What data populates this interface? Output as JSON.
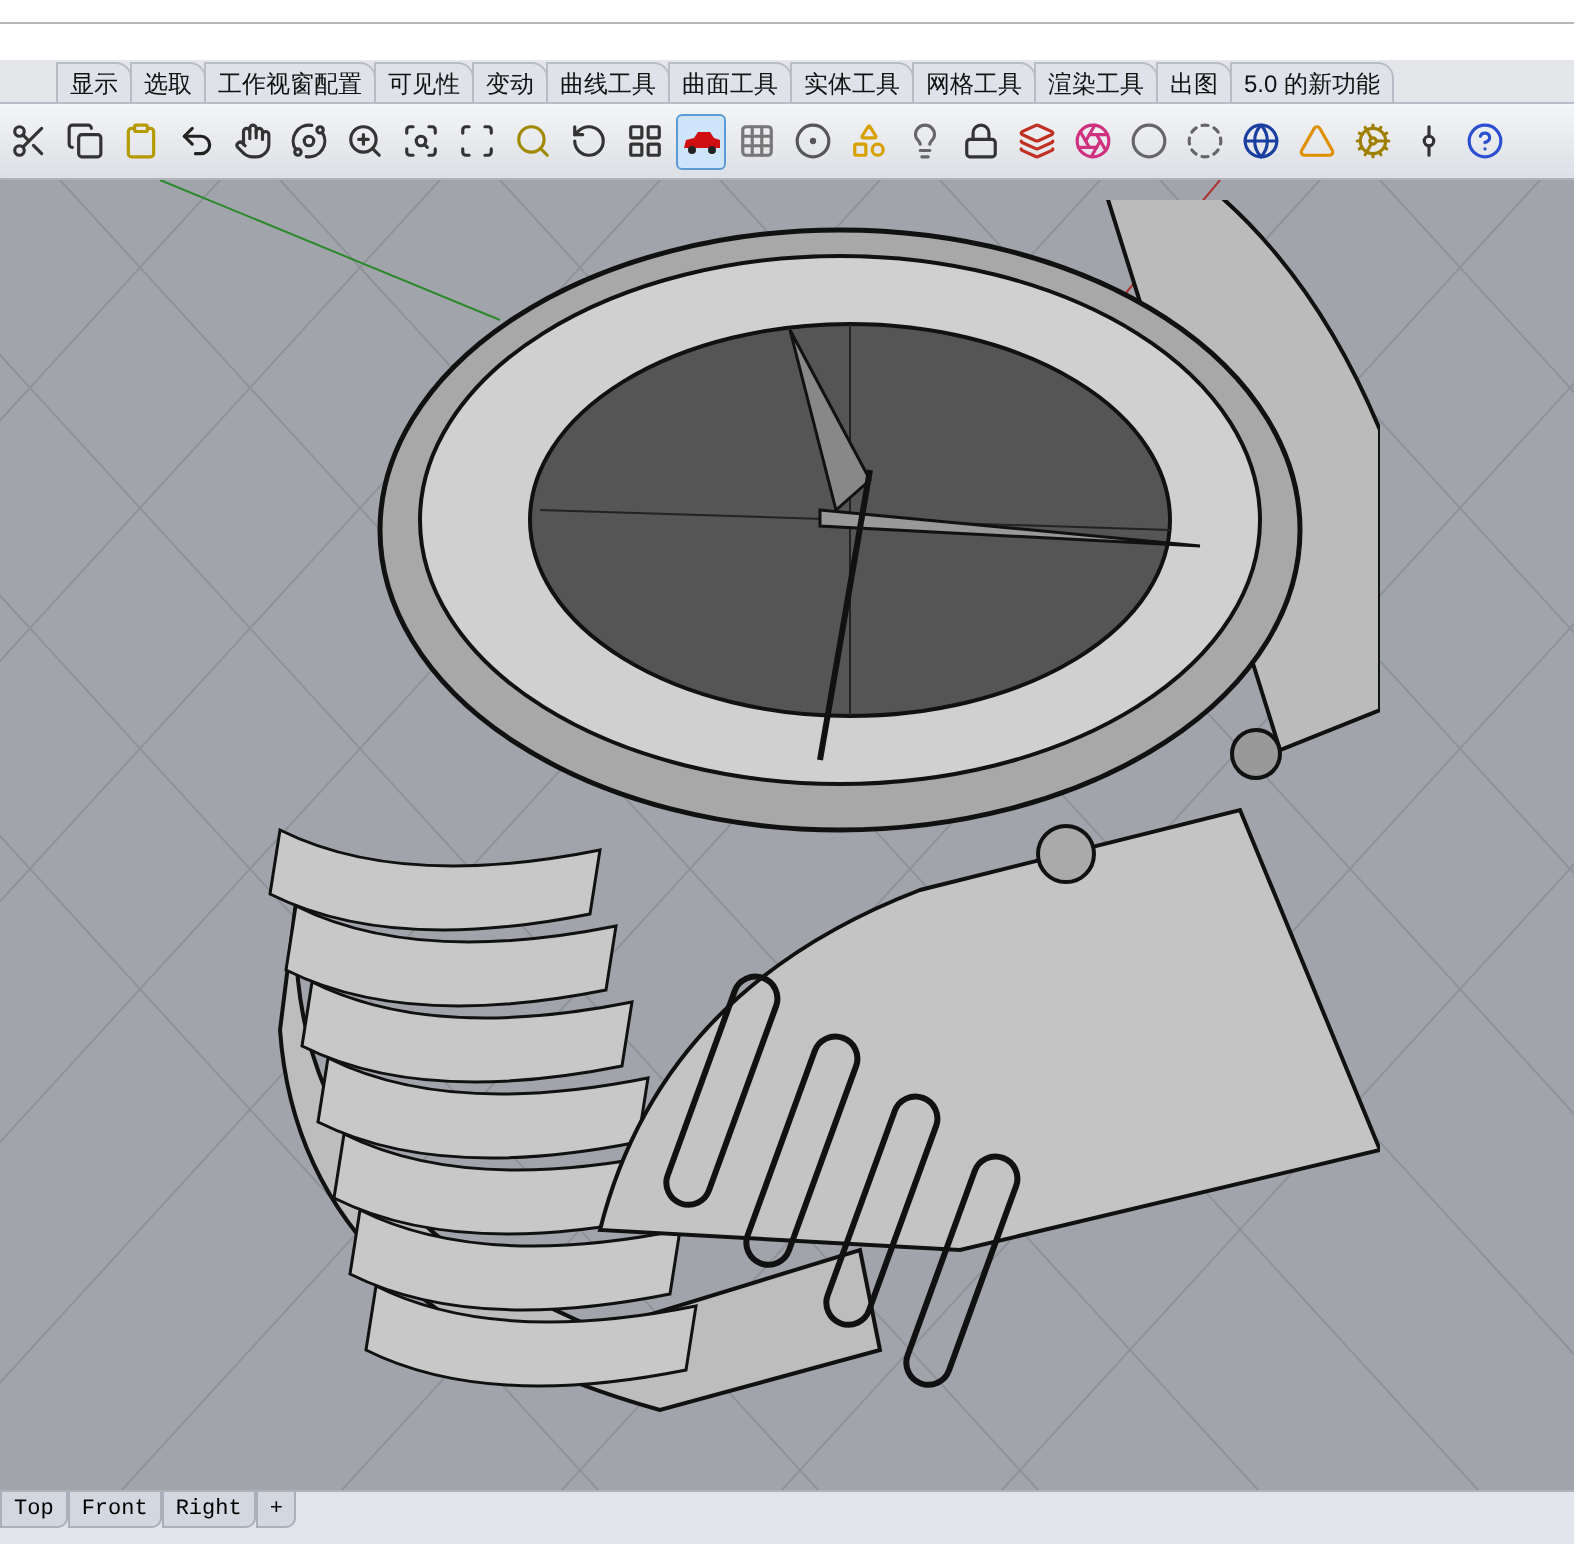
{
  "ribbon_tabs": [
    {
      "label": "显示",
      "selected": false
    },
    {
      "label": "选取",
      "selected": false
    },
    {
      "label": "工作视窗配置",
      "selected": false
    },
    {
      "label": "可见性",
      "selected": false
    },
    {
      "label": "变动",
      "selected": false
    },
    {
      "label": "曲线工具",
      "selected": false
    },
    {
      "label": "曲面工具",
      "selected": false
    },
    {
      "label": "实体工具",
      "selected": false
    },
    {
      "label": "网格工具",
      "selected": false
    },
    {
      "label": "渲染工具",
      "selected": false
    },
    {
      "label": "出图",
      "selected": false
    },
    {
      "label": "5.0 的新功能",
      "selected": false
    }
  ],
  "toolbar": {
    "buttons": [
      {
        "selected": false
      },
      {
        "selected": false
      },
      {
        "selected": false
      },
      {
        "selected": false
      },
      {
        "selected": false
      },
      {
        "selected": false
      },
      {
        "selected": false
      },
      {
        "selected": false
      },
      {
        "selected": false
      },
      {
        "selected": false
      },
      {
        "selected": false
      },
      {
        "selected": false
      },
      {
        "selected": true
      },
      {
        "selected": false
      },
      {
        "selected": false
      },
      {
        "selected": false
      },
      {
        "selected": false
      },
      {
        "selected": false
      },
      {
        "selected": false
      },
      {
        "selected": false
      },
      {
        "selected": false
      },
      {
        "selected": false
      },
      {
        "selected": false
      },
      {
        "selected": false
      },
      {
        "selected": false
      },
      {
        "selected": false
      },
      {
        "selected": false
      }
    ]
  },
  "viewport_tabs": [
    {
      "label": "Top",
      "selected": false
    },
    {
      "label": "Front",
      "selected": false
    },
    {
      "label": "Right",
      "selected": false
    },
    {
      "label": "+",
      "selected": false
    }
  ]
}
